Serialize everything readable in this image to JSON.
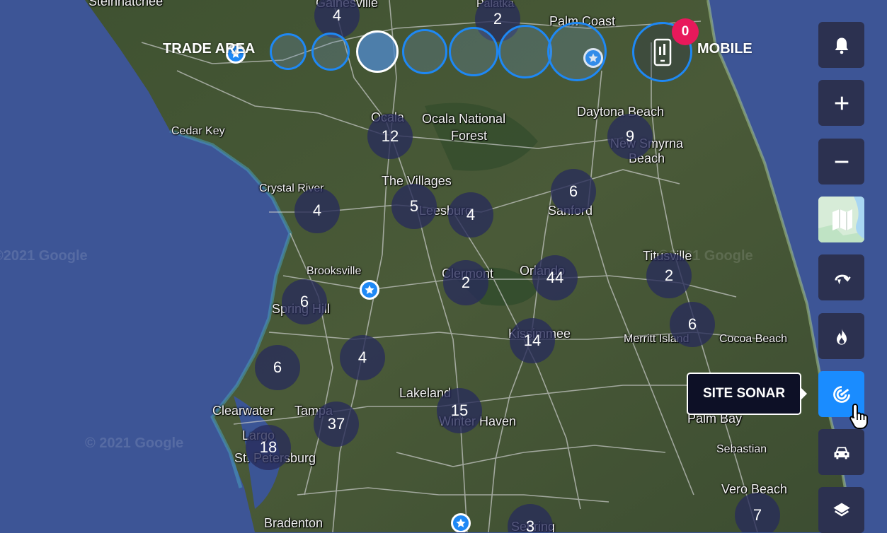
{
  "map": {
    "watermarks": [
      "©2021 Google",
      "© 2021 Google",
      "©2021 Google"
    ],
    "places": [
      {
        "name": "Steinhatchee",
        "cls": ""
      },
      {
        "name": "Gainesville",
        "cls": ""
      },
      {
        "name": "Palatka",
        "cls": "small"
      },
      {
        "name": "Palm Coast",
        "cls": ""
      },
      {
        "name": "Cedar Key",
        "cls": "small"
      },
      {
        "name": "Ocala",
        "cls": ""
      },
      {
        "name": "Ocala National",
        "cls": ""
      },
      {
        "name": "Forest",
        "cls": ""
      },
      {
        "name": "Daytona Beach",
        "cls": ""
      },
      {
        "name": "New Smyrna",
        "cls": ""
      },
      {
        "name": "Beach",
        "cls": ""
      },
      {
        "name": "Crystal River",
        "cls": "small"
      },
      {
        "name": "The Villages",
        "cls": ""
      },
      {
        "name": "Leesburg",
        "cls": ""
      },
      {
        "name": "Sanford",
        "cls": ""
      },
      {
        "name": "Brooksville",
        "cls": "small"
      },
      {
        "name": "Clermont",
        "cls": ""
      },
      {
        "name": "Orlando",
        "cls": ""
      },
      {
        "name": "Titusville",
        "cls": ""
      },
      {
        "name": "Spring Hill",
        "cls": ""
      },
      {
        "name": "Kissimmee",
        "cls": ""
      },
      {
        "name": "Merritt Island",
        "cls": "small"
      },
      {
        "name": "Cocoa Beach",
        "cls": "small"
      },
      {
        "name": "Lakeland",
        "cls": ""
      },
      {
        "name": "Clearwater",
        "cls": ""
      },
      {
        "name": "Tampa",
        "cls": ""
      },
      {
        "name": "Winter Haven",
        "cls": ""
      },
      {
        "name": "Largo",
        "cls": ""
      },
      {
        "name": "St. Petersburg",
        "cls": ""
      },
      {
        "name": "Palm Bay",
        "cls": ""
      },
      {
        "name": "Sebastian",
        "cls": "small"
      },
      {
        "name": "Vero Beach",
        "cls": ""
      },
      {
        "name": "Bradenton",
        "cls": ""
      },
      {
        "name": "Sebring",
        "cls": ""
      }
    ],
    "clusters": [
      "4",
      "2",
      "12",
      "9",
      "6",
      "4",
      "5",
      "4",
      "2",
      "44",
      "2",
      "6",
      "6",
      "14",
      "6",
      "4",
      "15",
      "37",
      "18",
      "7",
      "3"
    ]
  },
  "trade_area": {
    "label": "TRADE AREA",
    "rings": 7,
    "selected_index": 2
  },
  "mobile": {
    "label": "MOBILE",
    "badge_count": "0"
  },
  "controls": [
    {
      "name": "notifications-button",
      "icon": "bell-icon"
    },
    {
      "name": "zoom-in-button",
      "icon": "plus-icon"
    },
    {
      "name": "zoom-out-button",
      "icon": "minus-icon"
    },
    {
      "name": "map-type-button",
      "icon": "map-thumbnail-icon"
    },
    {
      "name": "route-button",
      "icon": "route-icon"
    },
    {
      "name": "heatmap-button",
      "icon": "flame-icon"
    },
    {
      "name": "site-sonar-button",
      "icon": "sonar-icon"
    },
    {
      "name": "traffic-button",
      "icon": "car-icon"
    },
    {
      "name": "layers-button",
      "icon": "layers-icon"
    }
  ],
  "tooltip": {
    "text": "SITE SONAR"
  },
  "colors": {
    "accent": "#1e88f5",
    "active_control": "#1a8cff",
    "control_bg": "#2c3150",
    "badge": "#e8195b",
    "cluster_bg": "#282c5a"
  }
}
